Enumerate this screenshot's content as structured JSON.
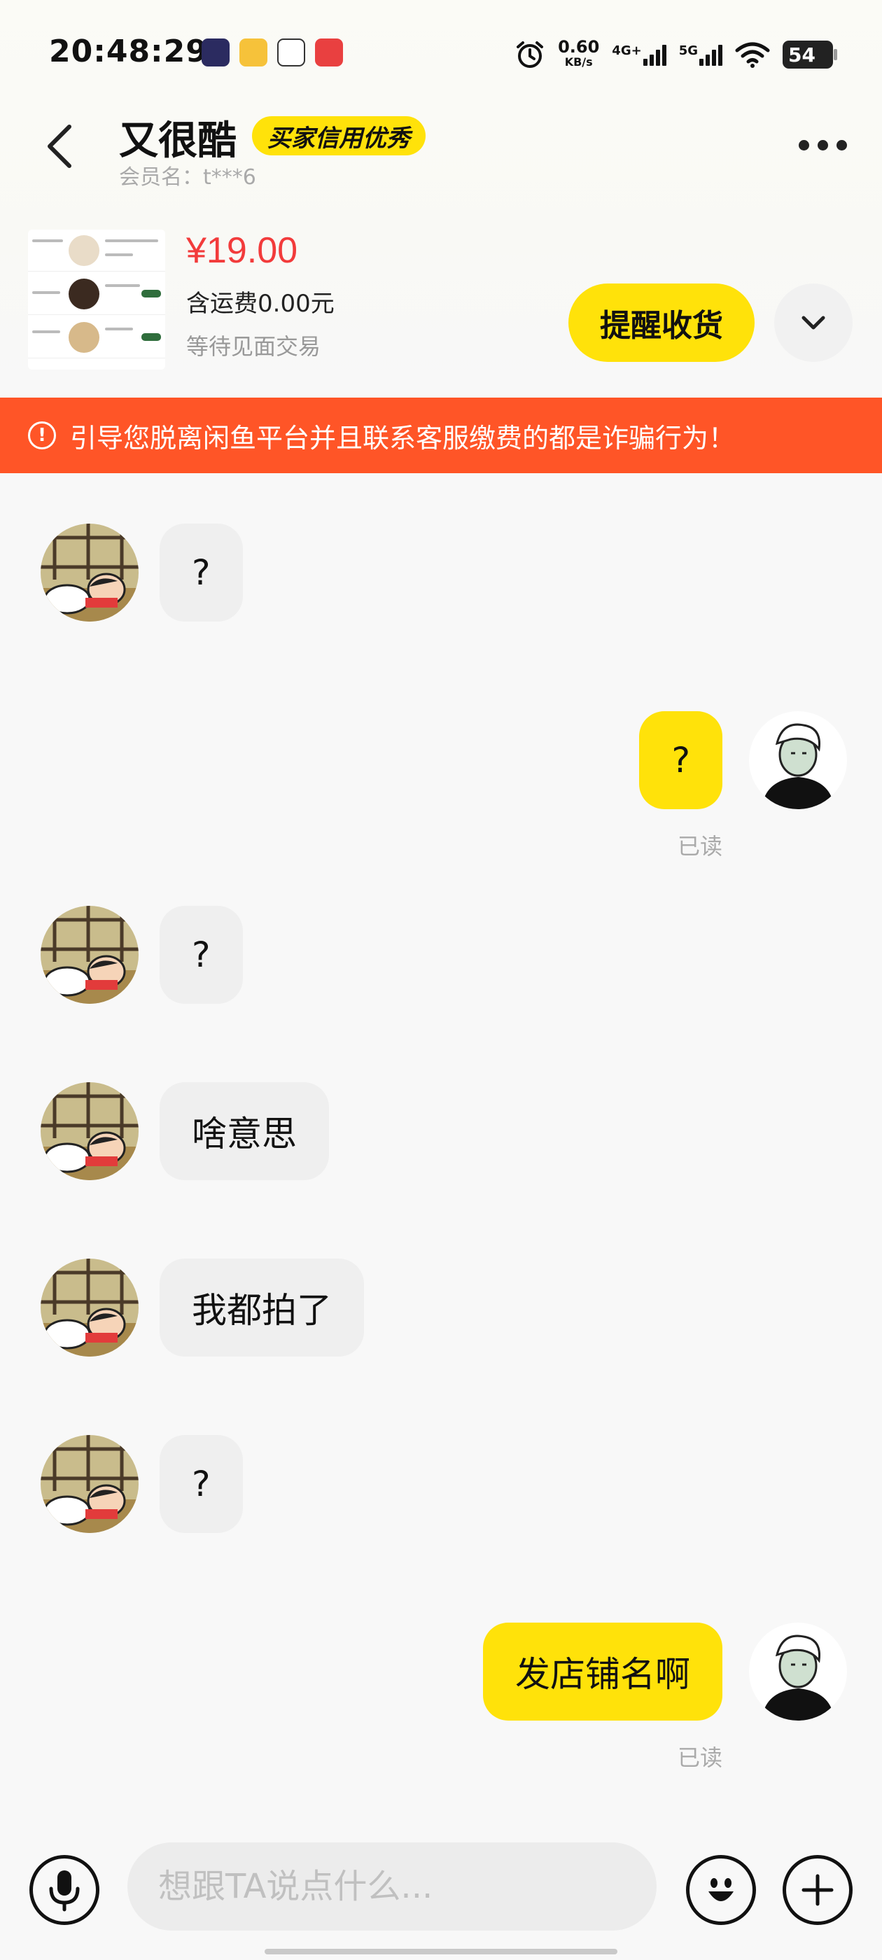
{
  "status_bar": {
    "time": "20:48:29",
    "net_speed_value": "0.60",
    "net_speed_unit": "KB/s",
    "network_1": "4G+",
    "network_2": "5G",
    "battery": "54"
  },
  "header": {
    "title": "又很酷",
    "badge": "买家信用优秀",
    "member": "会员名：t***6"
  },
  "product": {
    "price": "¥19.00",
    "shipping": "含运费0.00元",
    "status": "等待见面交易",
    "remind_label": "提醒收货"
  },
  "warning": {
    "text": "引导您脱离闲鱼平台并且联系客服缴费的都是诈骗行为！"
  },
  "messages": [
    {
      "side": "left",
      "text": "?"
    },
    {
      "side": "right",
      "text": "?",
      "read": "已读"
    },
    {
      "side": "left",
      "text": "?"
    },
    {
      "side": "left",
      "text": "啥意思"
    },
    {
      "side": "left",
      "text": "我都拍了"
    },
    {
      "side": "left",
      "text": "?"
    },
    {
      "side": "right",
      "text": "发店铺名啊",
      "read": "已读"
    }
  ],
  "input": {
    "placeholder": "想跟TA说点什么..."
  },
  "colors": {
    "accent_yellow": "#ffe20a",
    "warning_orange": "#ff5527",
    "price_red": "#f23b3b"
  }
}
